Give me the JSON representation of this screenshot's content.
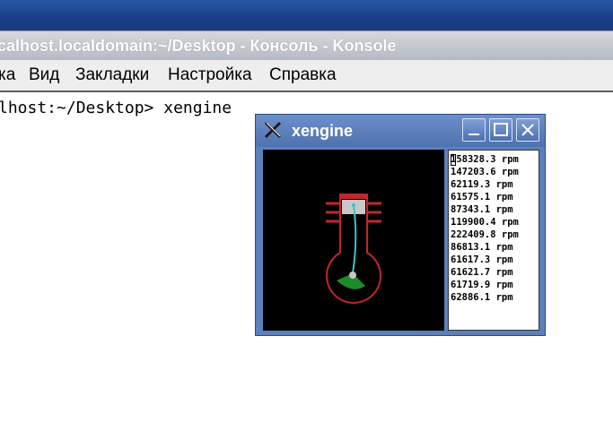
{
  "konsole": {
    "title": "calhost.localdomain:~/Desktop - Консоль - Konsole",
    "menu": [
      "ка",
      "Вид",
      "Закладки",
      "Настройка",
      "Справка"
    ],
    "terminal_line": "lhost:~/Desktop> xengine"
  },
  "xengine": {
    "title": "xengine",
    "controls": {
      "minimize": "minimize-icon",
      "maximize": "maximize-icon",
      "close": "close-icon"
    },
    "rpm_readings": [
      "158328.3 rpm",
      "147203.6 rpm",
      "62119.3 rpm",
      "61575.1 rpm",
      "87343.1 rpm",
      "119900.4 rpm",
      "222409.8 rpm",
      "86813.1 rpm",
      "61617.3 rpm",
      "61621.7 rpm",
      "61719.9 rpm",
      "62886.1 rpm"
    ],
    "colors": {
      "cylinder": "#c0282a",
      "rod": "#3fc2c0",
      "flywheel": "#1f8a2a",
      "background": "#000000"
    }
  }
}
